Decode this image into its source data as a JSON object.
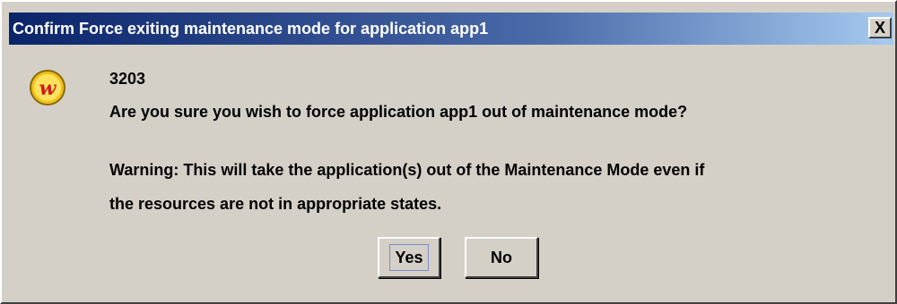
{
  "dialog": {
    "title": "Confirm Force exiting maintenance mode for application  app1",
    "close_glyph": "X",
    "icon": "web-logo-icon",
    "message_code": "3203",
    "question": "Are you sure you wish to force application app1 out of maintenance mode?",
    "warning_line1": "Warning: This will take the application(s) out of the Maintenance Mode even if",
    "warning_line2": "the resources are not in appropriate states.",
    "buttons": {
      "yes_label": "Yes",
      "no_label": "No"
    }
  },
  "colors": {
    "titlebar_start": "#0a246a",
    "titlebar_end": "#a6caf0",
    "dialog_bg": "#d4d0c8",
    "icon_red": "#cc1f1f",
    "icon_yellow": "#ffd700"
  }
}
